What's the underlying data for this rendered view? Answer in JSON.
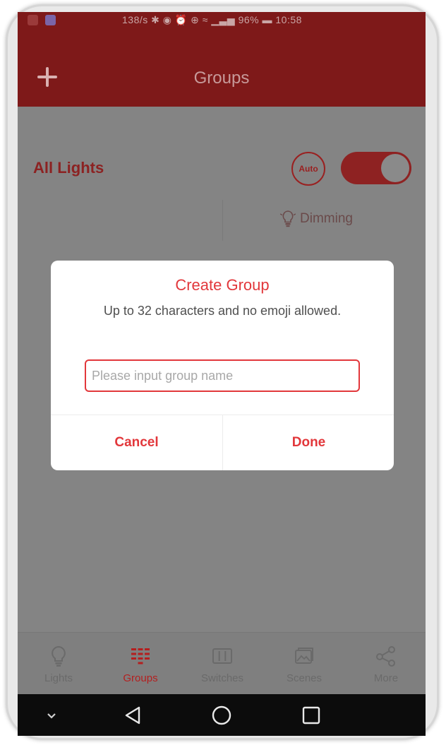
{
  "status_bar": {
    "text": "138/s ✱ ◉ ⏰ ⊕ ≈ ▁▃▅ 96% ▬ 10:58"
  },
  "app_bar": {
    "title": "Groups",
    "add_icon": "plus-icon"
  },
  "group": {
    "name": "All Lights",
    "auto_label": "Auto",
    "toggle_on": true,
    "dimming_label": "Dimming"
  },
  "dialog": {
    "title": "Create Group",
    "hint": "Up to 32 characters and no emoji allowed.",
    "input_value": "",
    "input_placeholder": "Please input group name",
    "cancel_label": "Cancel",
    "done_label": "Done"
  },
  "tabs": [
    {
      "label": "Lights",
      "icon": "bulb-icon",
      "active": false
    },
    {
      "label": "Groups",
      "icon": "groups-icon",
      "active": true
    },
    {
      "label": "Switches",
      "icon": "switch-panel-icon",
      "active": false
    },
    {
      "label": "Scenes",
      "icon": "scenes-icon",
      "active": false
    },
    {
      "label": "More",
      "icon": "share-nodes-icon",
      "active": false
    }
  ],
  "colors": {
    "accent": "#e2373b",
    "app_bar": "#7e1919",
    "overlay_background": "#848484"
  }
}
